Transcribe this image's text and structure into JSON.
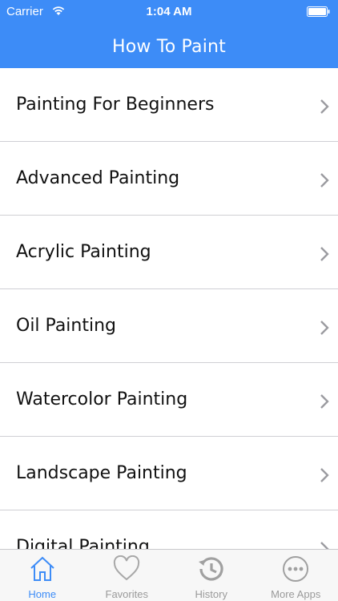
{
  "status_bar": {
    "carrier": "Carrier",
    "time": "1:04 AM"
  },
  "nav": {
    "title": "How To Paint"
  },
  "list": {
    "items": [
      {
        "label": "Painting For Beginners"
      },
      {
        "label": "Advanced Painting"
      },
      {
        "label": "Acrylic Painting"
      },
      {
        "label": "Oil Painting"
      },
      {
        "label": "Watercolor Painting"
      },
      {
        "label": "Landscape Painting"
      },
      {
        "label": "Digital Painting"
      }
    ]
  },
  "tabbar": {
    "tabs": [
      {
        "label": "Home",
        "icon": "home-icon",
        "active": true
      },
      {
        "label": "Favorites",
        "icon": "heart-icon",
        "active": false
      },
      {
        "label": "History",
        "icon": "history-icon",
        "active": false
      },
      {
        "label": "More Apps",
        "icon": "more-icon",
        "active": false
      }
    ]
  },
  "colors": {
    "accent": "#3d8cf7",
    "tab_inactive": "#9a9a9a",
    "separator": "#cfcfd4"
  }
}
